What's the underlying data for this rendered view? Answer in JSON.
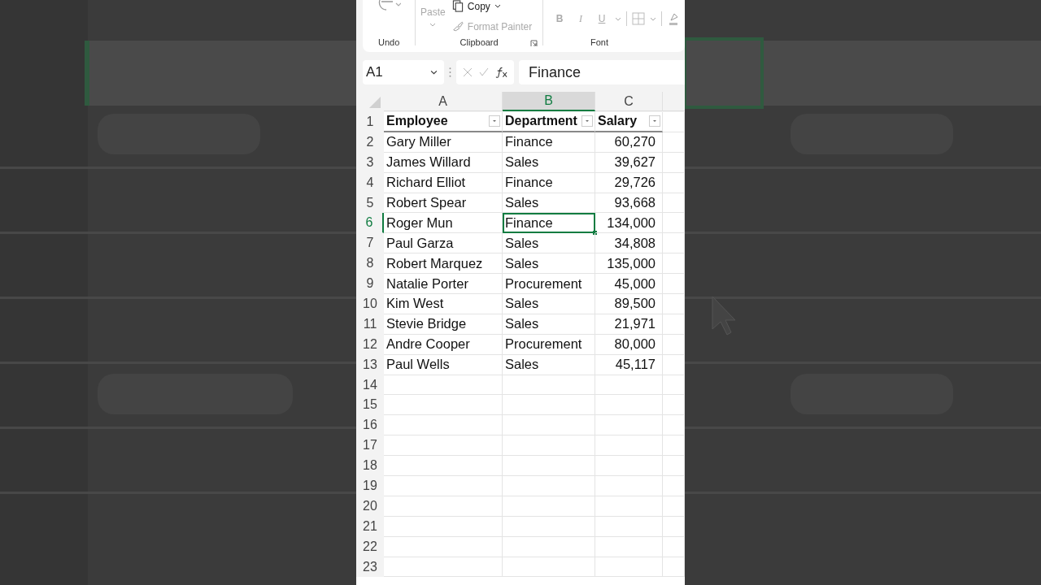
{
  "ribbon": {
    "groups": [
      {
        "kind": "undo",
        "label": "Undo"
      },
      {
        "kind": "clipboard",
        "label": "Clipboard",
        "commands": [
          {
            "label": "Paste",
            "disabled": true
          },
          {
            "label": "Copy",
            "disabled": false
          },
          {
            "label": "Format Painter",
            "disabled": true
          }
        ]
      },
      {
        "kind": "font",
        "label": "Font",
        "buttons": [
          {
            "label": "B",
            "disabled": true
          },
          {
            "label": "I",
            "disabled": true
          },
          {
            "label": "U",
            "disabled": true
          }
        ]
      }
    ]
  },
  "formula_bar": {
    "name_box": "A1",
    "value": "Finance"
  },
  "columns": [
    {
      "label": "A",
      "selected": false
    },
    {
      "label": "B",
      "selected": true
    },
    {
      "label": "C",
      "selected": false
    }
  ],
  "rows": [
    {
      "number": "1",
      "kind": "header",
      "selected": false,
      "cells": [
        {
          "text": "Employee",
          "selected": false
        },
        {
          "text": "Department",
          "selected": false
        },
        {
          "text": "Salary",
          "selected": false
        }
      ]
    },
    {
      "number": "2",
      "kind": "data",
      "selected": false,
      "cells": [
        {
          "text": "Gary Miller",
          "selected": false
        },
        {
          "text": "Finance",
          "selected": false
        },
        {
          "text": "60,270",
          "selected": false
        }
      ]
    },
    {
      "number": "3",
      "kind": "data",
      "selected": false,
      "cells": [
        {
          "text": "James Willard",
          "selected": false
        },
        {
          "text": "Sales",
          "selected": false
        },
        {
          "text": "39,627",
          "selected": false
        }
      ]
    },
    {
      "number": "4",
      "kind": "data",
      "selected": false,
      "cells": [
        {
          "text": "Richard Elliot",
          "selected": false
        },
        {
          "text": "Finance",
          "selected": false
        },
        {
          "text": "29,726",
          "selected": false
        }
      ]
    },
    {
      "number": "5",
      "kind": "data",
      "selected": false,
      "cells": [
        {
          "text": "Robert Spear",
          "selected": false
        },
        {
          "text": "Sales",
          "selected": false
        },
        {
          "text": "93,668",
          "selected": false
        }
      ]
    },
    {
      "number": "6",
      "kind": "data",
      "selected": true,
      "cells": [
        {
          "text": "Roger Mun",
          "selected": false
        },
        {
          "text": "Finance",
          "selected": true
        },
        {
          "text": "134,000",
          "selected": false
        }
      ]
    },
    {
      "number": "7",
      "kind": "data",
      "selected": false,
      "cells": [
        {
          "text": "Paul Garza",
          "selected": false
        },
        {
          "text": "Sales",
          "selected": false
        },
        {
          "text": "34,808",
          "selected": false
        }
      ]
    },
    {
      "number": "8",
      "kind": "data",
      "selected": false,
      "cells": [
        {
          "text": "Robert Marquez",
          "selected": false
        },
        {
          "text": "Sales",
          "selected": false
        },
        {
          "text": "135,000",
          "selected": false
        }
      ]
    },
    {
      "number": "9",
      "kind": "data",
      "selected": false,
      "cells": [
        {
          "text": "Natalie Porter",
          "selected": false
        },
        {
          "text": "Procurement",
          "selected": false
        },
        {
          "text": "45,000",
          "selected": false
        }
      ]
    },
    {
      "number": "10",
      "kind": "data",
      "selected": false,
      "cells": [
        {
          "text": "Kim West",
          "selected": false
        },
        {
          "text": "Sales",
          "selected": false
        },
        {
          "text": "89,500",
          "selected": false
        }
      ]
    },
    {
      "number": "11",
      "kind": "data",
      "selected": false,
      "cells": [
        {
          "text": "Stevie Bridge",
          "selected": false
        },
        {
          "text": "Sales",
          "selected": false
        },
        {
          "text": "21,971",
          "selected": false
        }
      ]
    },
    {
      "number": "12",
      "kind": "data",
      "selected": false,
      "cells": [
        {
          "text": "Andre Cooper",
          "selected": false
        },
        {
          "text": "Procurement",
          "selected": false
        },
        {
          "text": "80,000",
          "selected": false
        }
      ]
    },
    {
      "number": "13",
      "kind": "data",
      "selected": false,
      "cells": [
        {
          "text": "Paul Wells",
          "selected": false
        },
        {
          "text": "Sales",
          "selected": false
        },
        {
          "text": "45,117",
          "selected": false
        }
      ]
    },
    {
      "number": "14",
      "kind": "empty",
      "selected": false
    },
    {
      "number": "15",
      "kind": "empty",
      "selected": false
    },
    {
      "number": "16",
      "kind": "empty",
      "selected": false
    },
    {
      "number": "17",
      "kind": "empty",
      "selected": false
    },
    {
      "number": "18",
      "kind": "empty",
      "selected": false
    },
    {
      "number": "19",
      "kind": "empty",
      "selected": false
    },
    {
      "number": "20",
      "kind": "empty",
      "selected": false
    },
    {
      "number": "21",
      "kind": "empty",
      "selected": false
    },
    {
      "number": "22",
      "kind": "empty",
      "selected": false
    },
    {
      "number": "23",
      "kind": "empty",
      "selected": false
    }
  ]
}
